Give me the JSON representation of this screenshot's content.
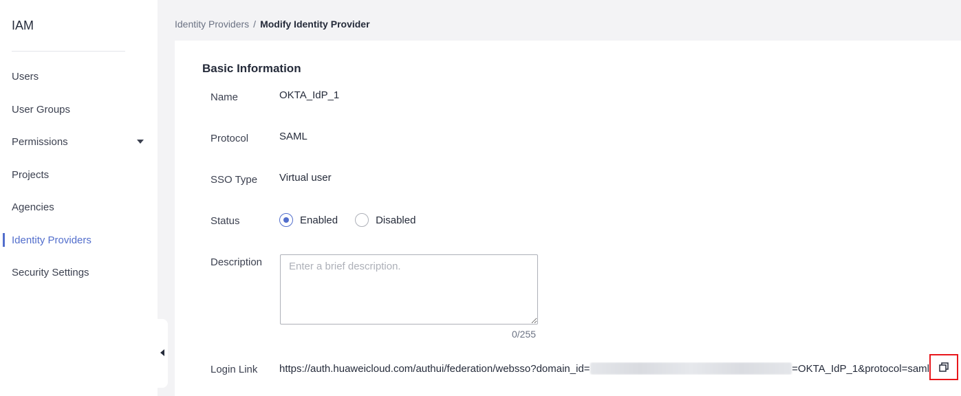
{
  "sidebar": {
    "title": "IAM",
    "items": [
      {
        "label": "Users"
      },
      {
        "label": "User Groups"
      },
      {
        "label": "Permissions"
      },
      {
        "label": "Projects"
      },
      {
        "label": "Agencies"
      },
      {
        "label": "Identity Providers"
      },
      {
        "label": "Security Settings"
      }
    ],
    "active_item": "Identity Providers"
  },
  "breadcrumb": {
    "parent": "Identity Providers",
    "separator": "/",
    "current": "Modify Identity Provider"
  },
  "form": {
    "section_title": "Basic Information",
    "name": {
      "label": "Name",
      "value": "OKTA_IdP_1"
    },
    "protocol": {
      "label": "Protocol",
      "value": "SAML"
    },
    "sso_type": {
      "label": "SSO Type",
      "value": "Virtual user"
    },
    "status": {
      "label": "Status",
      "options": [
        "Enabled",
        "Disabled"
      ],
      "selected": "Enabled"
    },
    "description": {
      "label": "Description",
      "placeholder": "Enter a brief description.",
      "value": "",
      "counter": "0/255"
    },
    "login_link": {
      "label": "Login Link",
      "prefix": "https://auth.huaweicloud.com/authui/federation/websso?domain_id=",
      "suffix": "=OKTA_IdP_1&protocol=saml"
    }
  },
  "icons": {
    "permissions_expand": "chevron-down-icon",
    "collapse": "chevron-left-icon",
    "copy": "copy-icon"
  },
  "colors": {
    "accent": "#526ecc",
    "highlight_border": "#e8161b"
  }
}
